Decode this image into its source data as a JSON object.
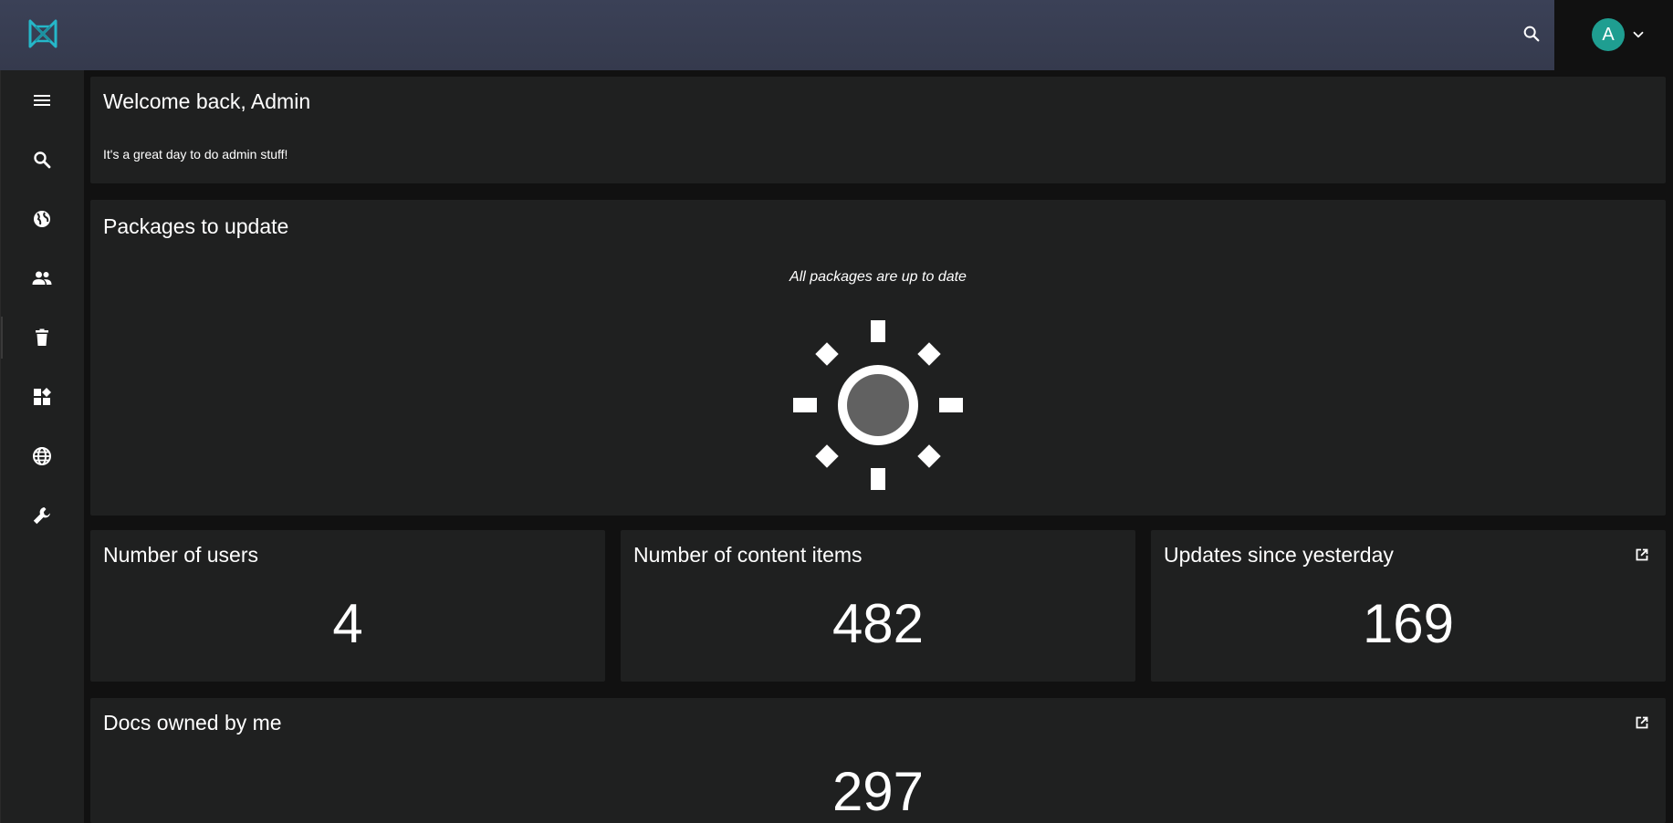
{
  "topbar": {
    "logo_icon": "umbraco-logo-icon",
    "search_icon": "search-icon",
    "avatar_initial": "A",
    "accent": "#1f9e91"
  },
  "sidebar": {
    "items": [
      {
        "icon": "menu-icon"
      },
      {
        "icon": "search-icon"
      },
      {
        "icon": "globe-filled-icon"
      },
      {
        "icon": "users-icon"
      },
      {
        "icon": "trash-icon"
      },
      {
        "icon": "dashboard-icon"
      },
      {
        "icon": "globe-outline-icon"
      },
      {
        "icon": "wrench-icon"
      }
    ]
  },
  "welcome": {
    "title": "Welcome back, Admin",
    "subtitle": "It's a great day to do admin stuff!"
  },
  "packages": {
    "title": "Packages to update",
    "status": "All packages are up to date"
  },
  "stats": {
    "users": {
      "title": "Number of users",
      "value": "4"
    },
    "content": {
      "title": "Number of content items",
      "value": "482"
    },
    "updates": {
      "title": "Updates since yesterday",
      "value": "169"
    }
  },
  "docs": {
    "title": "Docs owned by me",
    "value": "297"
  }
}
